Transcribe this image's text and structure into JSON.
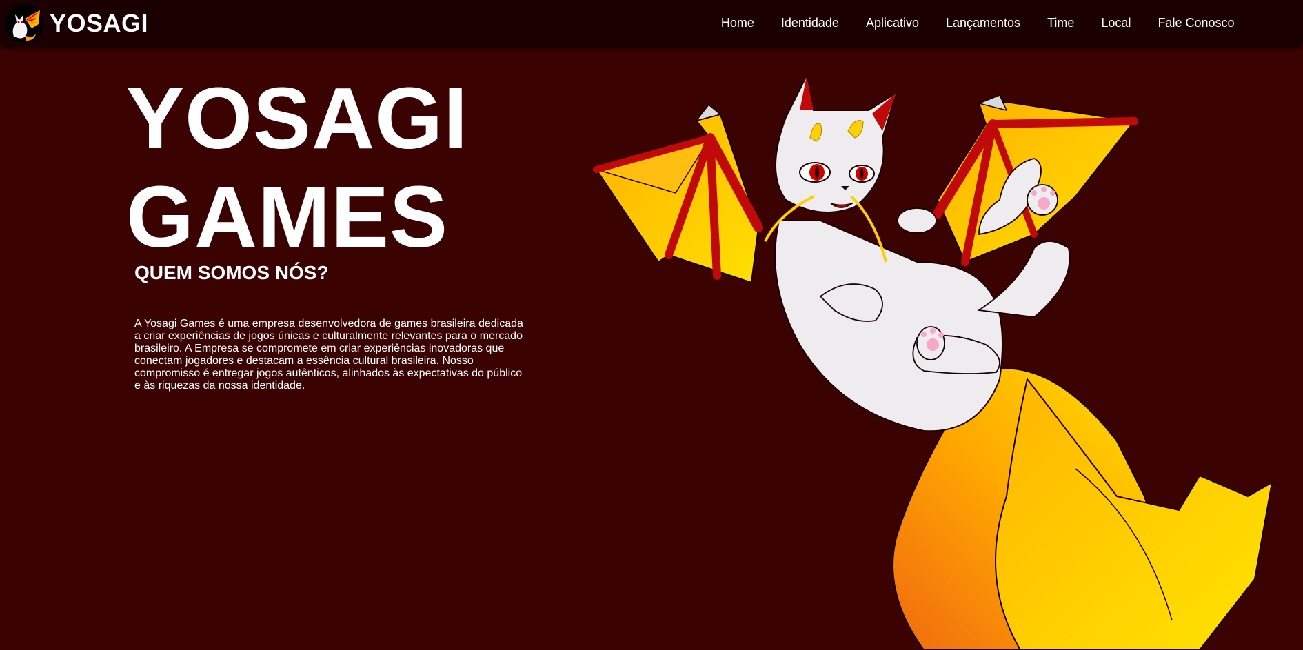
{
  "brand": {
    "name": "YOSAGI",
    "logo_icon": "dragon-cat-logo-icon"
  },
  "nav": {
    "items": [
      {
        "label": "Home"
      },
      {
        "label": "Identidade"
      },
      {
        "label": "Aplicativo"
      },
      {
        "label": "Lançamentos"
      },
      {
        "label": "Time"
      },
      {
        "label": "Local"
      },
      {
        "label": "Fale Conosco"
      }
    ]
  },
  "hero": {
    "title_line1": "YOSAGI",
    "title_line2": "GAMES",
    "section_heading": "QUEM SOMOS NÓS?",
    "about": "A Yosagi Games é uma empresa desenvolvedora de games brasileira dedicada a criar experiências de jogos únicas e culturalmente relevantes para o mercado brasileiro. A Empresa se compromete em criar experiências inovadoras que conectam jogadores e destacam a essência cultural brasileira. Nosso compromisso é entregar jogos autênticos, alinhados às expectativas do público e às riquezas da nossa identidade.",
    "illustration": "winged-cat-mascot-illustration"
  },
  "colors": {
    "background": "#3b0202",
    "navbar": "#1a0000",
    "text": "#ffffff",
    "wing_yellow": "#ffc20e",
    "wing_red": "#c00a0a",
    "tail_orange": "#f07a10",
    "cat_white": "#efecf0"
  }
}
